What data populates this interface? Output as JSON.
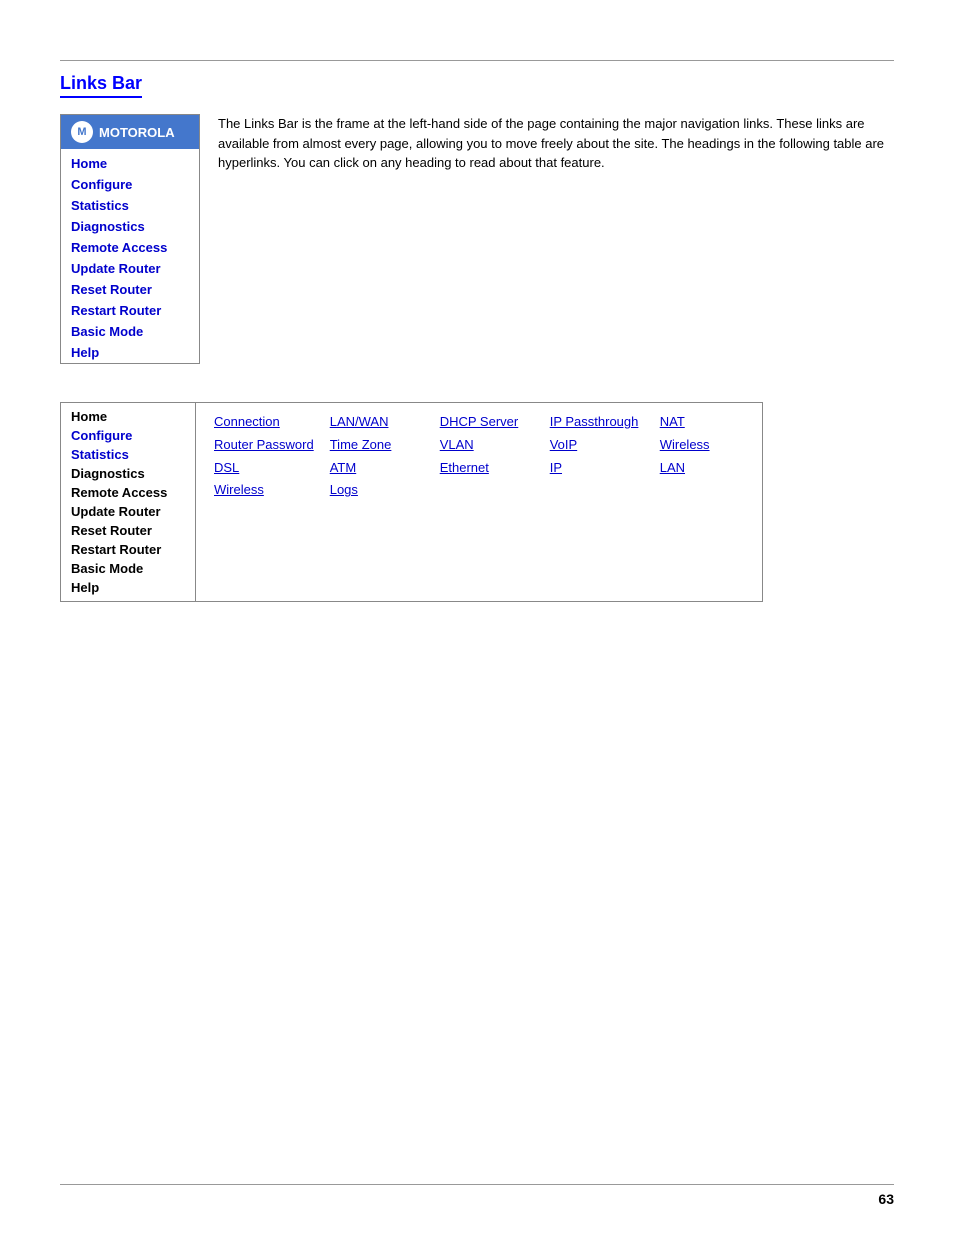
{
  "page": {
    "title": "Links Bar",
    "page_number": "63",
    "description": "The Links Bar is the frame at the left-hand side of the page containing the major navigation links. These links are available from almost every page, allowing you to move freely about the site. The headings in the following table are hyperlinks. You can click on any heading to read about that feature."
  },
  "sidebar1": {
    "logo_text": "MOTOROLA",
    "nav_items": [
      "Home",
      "Configure",
      "Statistics",
      "Diagnostics",
      "Remote Access",
      "Update Router",
      "Reset Router",
      "Restart Router",
      "Basic Mode",
      "Help"
    ]
  },
  "nav_table": {
    "sidebar_items": [
      {
        "label": "Home",
        "blue": false
      },
      {
        "label": "Configure",
        "blue": true
      },
      {
        "label": "Statistics",
        "blue": true
      },
      {
        "label": "Diagnostics",
        "blue": false
      },
      {
        "label": "Remote Access",
        "blue": false
      },
      {
        "label": "Update Router",
        "blue": false
      },
      {
        "label": "Reset Router",
        "blue": false
      },
      {
        "label": "Restart Router",
        "blue": false
      },
      {
        "label": "Basic Mode",
        "blue": false
      },
      {
        "label": "Help",
        "blue": false
      }
    ],
    "col1": [
      "Connection",
      "Router Password",
      "DSL",
      "Wireless"
    ],
    "col2": [
      "LAN/WAN",
      "Time Zone",
      "ATM",
      "Logs"
    ],
    "col3": [
      "DHCP Server",
      "VLAN",
      "Ethernet"
    ],
    "col4": [
      "IP Passthrough",
      "VoIP",
      "IP"
    ],
    "col5": [
      "NAT",
      "Wireless",
      "LAN"
    ]
  }
}
